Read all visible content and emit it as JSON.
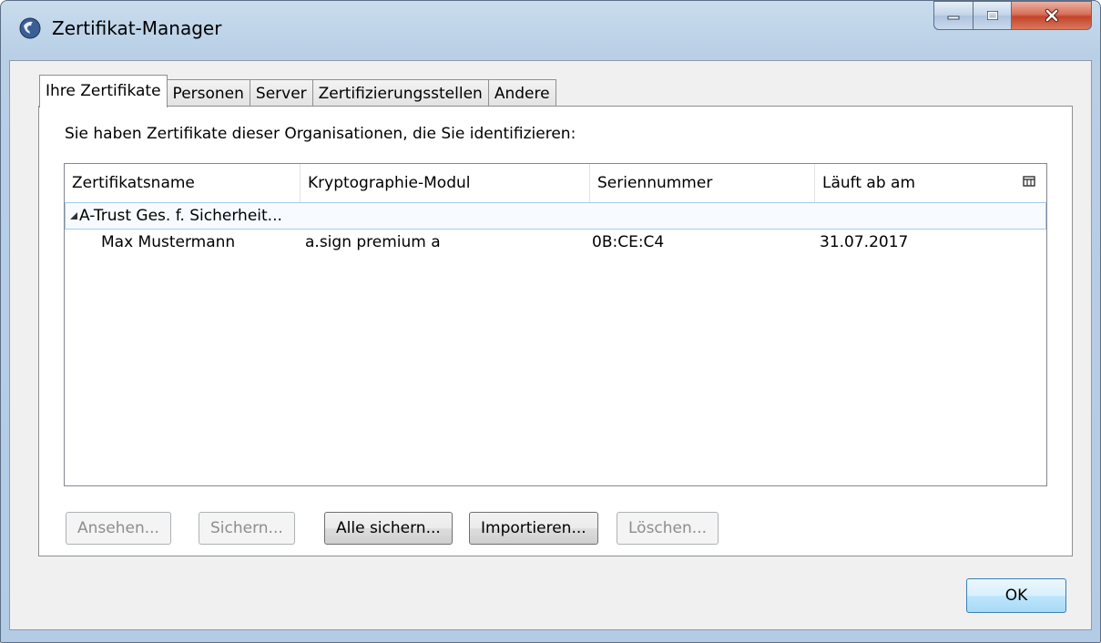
{
  "window": {
    "title": "Zertifikat-Manager",
    "icon": "firefox-globe-icon",
    "controls": {
      "minimize": "minimize-icon",
      "maximize": "maximize-icon",
      "close": "close-icon"
    }
  },
  "tabs": [
    {
      "label": "Ihre Zertifikate",
      "active": true
    },
    {
      "label": "Personen",
      "active": false
    },
    {
      "label": "Server",
      "active": false
    },
    {
      "label": "Zertifizierungsstellen",
      "active": false
    },
    {
      "label": "Andere",
      "active": false
    }
  ],
  "panel": {
    "intro": "Sie haben Zertifikate dieser Organisationen, die Sie identifizieren:",
    "columns": [
      "Zertifikatsname",
      "Kryptographie-Modul",
      "Seriennummer",
      "Läuft ab am"
    ],
    "column_picker_icon": "column-picker-icon",
    "groups": [
      {
        "name": "A-Trust Ges. f. Sicherheit...",
        "expanded": true,
        "certificates": [
          {
            "name": "Max Mustermann",
            "module": "a.sign premium a",
            "serial": "0B:CE:C4",
            "expires": "31.07.2017"
          }
        ]
      }
    ]
  },
  "buttons": {
    "view": {
      "label": "Ansehen...",
      "enabled": false
    },
    "backup": {
      "label": "Sichern...",
      "enabled": false
    },
    "backup_all": {
      "label": "Alle sichern...",
      "enabled": true
    },
    "import": {
      "label": "Importieren...",
      "enabled": true
    },
    "delete": {
      "label": "Löschen...",
      "enabled": false
    },
    "ok": {
      "label": "OK",
      "enabled": true
    }
  },
  "colors": {
    "titlebar": "#b8cfe6",
    "close_button": "#c3442b",
    "selection_border": "#a6c9ee",
    "ok_button": "#bee6fd"
  }
}
